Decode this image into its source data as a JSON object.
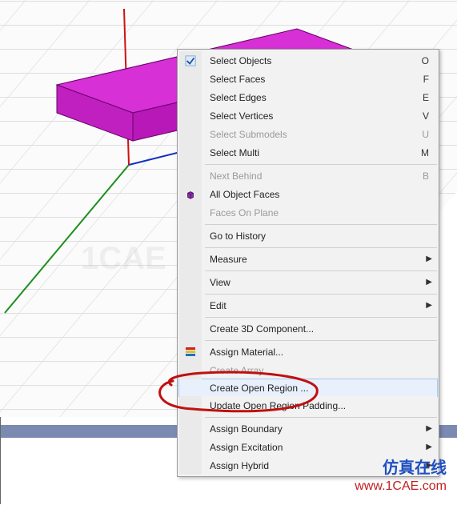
{
  "watermark": "1CAE",
  "menu": {
    "select_objects": "Select Objects",
    "select_faces": "Select Faces",
    "select_edges": "Select Edges",
    "select_vertices": "Select Vertices",
    "select_submodels": "Select Submodels",
    "select_multi": "Select Multi",
    "next_behind": "Next Behind",
    "all_object_faces": "All Object Faces",
    "faces_on_plane": "Faces On Plane",
    "go_to_history": "Go to History",
    "measure": "Measure",
    "view": "View",
    "edit": "Edit",
    "create_3d_component": "Create 3D Component...",
    "assign_material": "Assign Material...",
    "create_array": "Create Array...",
    "create_open_region": "Create Open Region ...",
    "update_open_region_padding": "Update Open Region Padding...",
    "assign_boundary": "Assign Boundary",
    "assign_excitation": "Assign Excitation",
    "assign_hybrid": "Assign Hybrid",
    "sc": {
      "o": "O",
      "f": "F",
      "e": "E",
      "v": "V",
      "u": "U",
      "m": "M",
      "b": "B"
    }
  },
  "footer": {
    "cn": "仿真在线",
    "url": "www.1CAE.com"
  }
}
